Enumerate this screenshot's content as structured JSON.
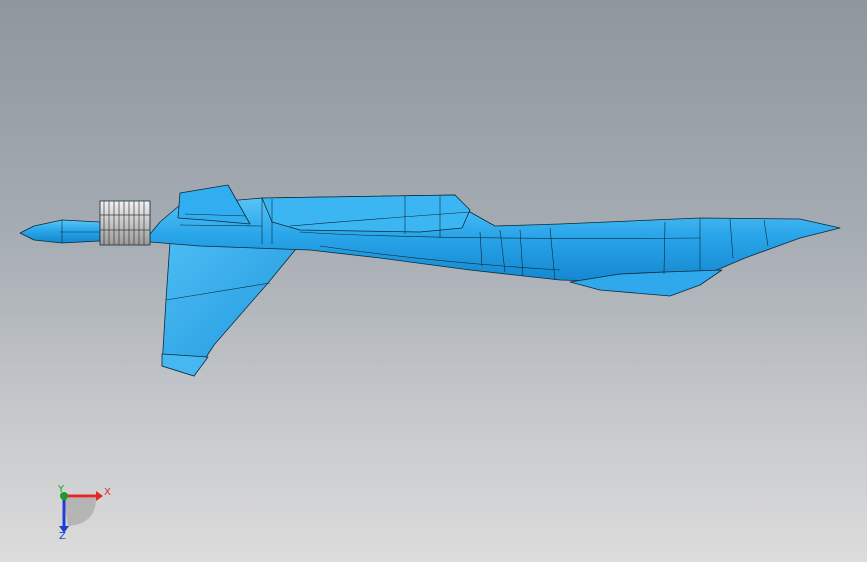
{
  "viewport": {
    "background_top": "#8e969e",
    "background_bottom": "#dcdcdc"
  },
  "model": {
    "part_color": "#27a7ea",
    "edge_color": "#0b2a3a",
    "nozzle_color": "#d8d8d8"
  },
  "triad": {
    "x_label": "X",
    "y_label": "Y",
    "z_label": "Z",
    "x_color": "#e0282a",
    "y_color": "#1e9a2a",
    "z_color": "#1f3fd2"
  }
}
